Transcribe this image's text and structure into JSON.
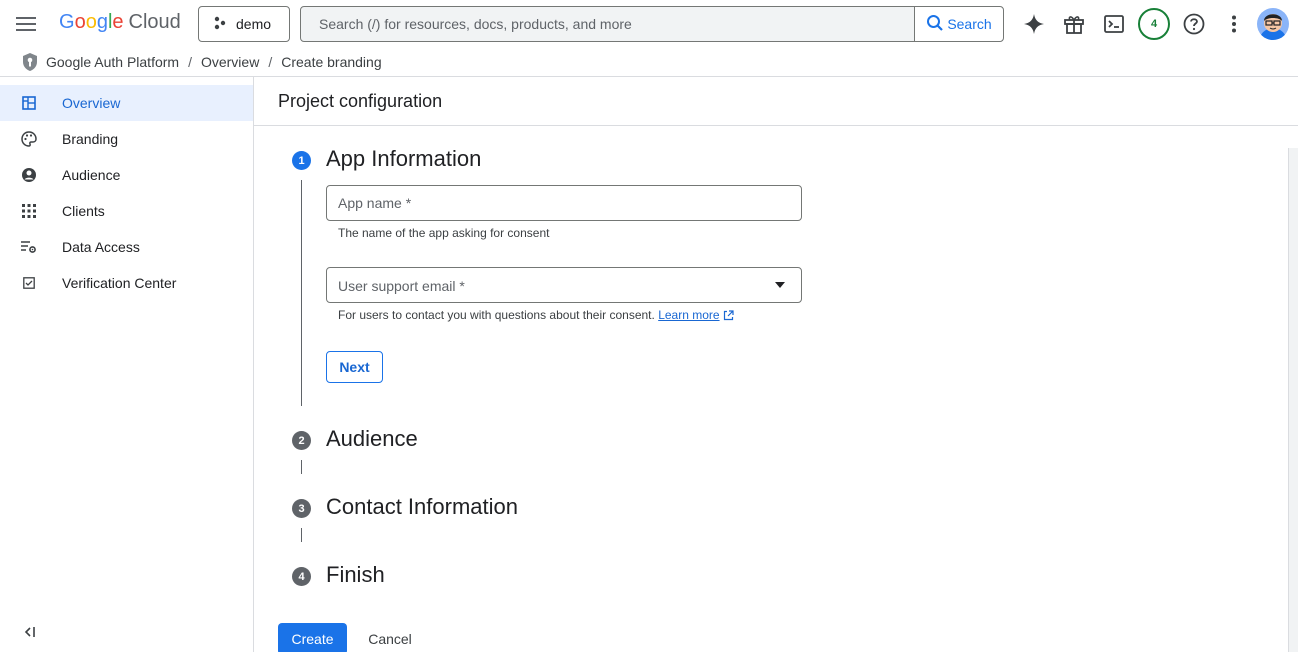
{
  "header": {
    "logo_google": [
      "G",
      "o",
      "o",
      "g",
      "l",
      "e"
    ],
    "logo_cloud": "Cloud",
    "project_name": "demo",
    "search_placeholder": "Search (/) for resources, docs, products, and more",
    "search_button": "Search",
    "notification_count": "4",
    "icons": [
      "menu-icon",
      "project-icon",
      "search-icon",
      "gemini-sparkle-icon",
      "gift-icon",
      "cloud-shell-icon",
      "help-icon",
      "more-vert-icon",
      "avatar"
    ]
  },
  "breadcrumb": {
    "items": [
      "Google Auth Platform",
      "Overview",
      "Create branding"
    ],
    "separator": "/"
  },
  "sidebar": {
    "items": [
      {
        "label": "Overview",
        "icon": "dashboard-icon",
        "active": true
      },
      {
        "label": "Branding",
        "icon": "palette-icon",
        "active": false
      },
      {
        "label": "Audience",
        "icon": "account-circle-icon",
        "active": false
      },
      {
        "label": "Clients",
        "icon": "apps-grid-icon",
        "active": false
      },
      {
        "label": "Data Access",
        "icon": "list-settings-icon",
        "active": false
      },
      {
        "label": "Verification Center",
        "icon": "checkbox-icon",
        "active": false
      }
    ],
    "collapse_icon": "collapse-sidebar-icon"
  },
  "main": {
    "title": "Project configuration",
    "steps": [
      {
        "number": "1",
        "title": "App Information",
        "active": true
      },
      {
        "number": "2",
        "title": "Audience",
        "active": false
      },
      {
        "number": "3",
        "title": "Contact Information",
        "active": false
      },
      {
        "number": "4",
        "title": "Finish",
        "active": false
      }
    ],
    "app_name": {
      "placeholder": "App name *",
      "value": "",
      "hint": "The name of the app asking for consent"
    },
    "support_email": {
      "label": "User support email *",
      "hint": "For users to contact you with questions about their consent.",
      "learn_more": "Learn more"
    },
    "next_button": "Next",
    "create_button": "Create",
    "cancel_button": "Cancel"
  },
  "colors": {
    "accent": "#1a73e8",
    "active_nav_bg": "#e8f0fe",
    "step_inactive": "#5f6368",
    "badge_green": "#188038"
  }
}
